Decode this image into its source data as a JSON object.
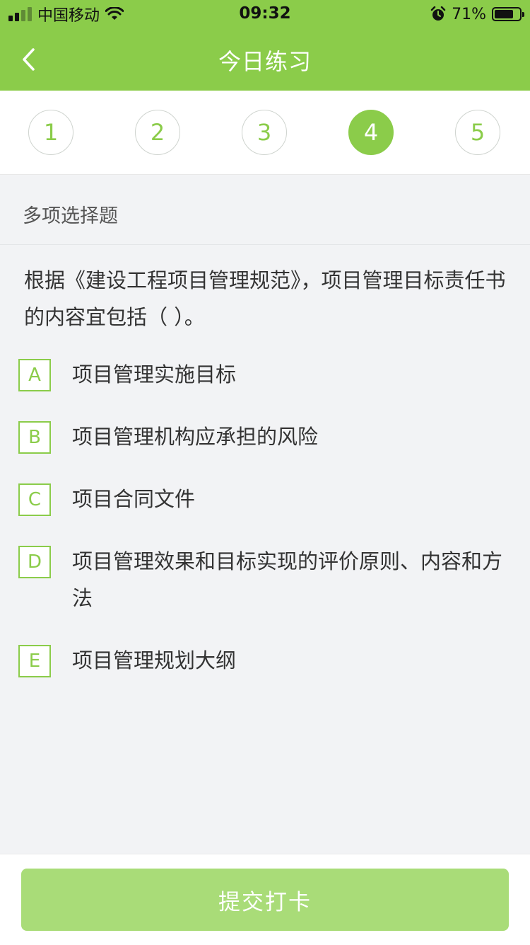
{
  "status_bar": {
    "carrier": "中国移动",
    "time": "09:32",
    "battery": "71%"
  },
  "header": {
    "title": "今日练习"
  },
  "steps": [
    "1",
    "2",
    "3",
    "4",
    "5"
  ],
  "active_step": "4",
  "question": {
    "type": "多项选择题",
    "text": "根据《建设工程项目管理规范》，项目管理目标责任书的内容宜包括（   ）。",
    "options": [
      {
        "letter": "A",
        "text": "项目管理实施目标"
      },
      {
        "letter": "B",
        "text": "项目管理机构应承担的风险"
      },
      {
        "letter": "C",
        "text": "项目合同文件"
      },
      {
        "letter": "D",
        "text": "项目管理效果和目标实现的评价原则、内容和方法"
      },
      {
        "letter": "E",
        "text": "项目管理规划大纲"
      }
    ]
  },
  "footer": {
    "submit_label": "提交打卡"
  },
  "colors": {
    "brand_green": "#8bcc4a",
    "button_green": "#a9dc78",
    "background": "#f2f3f5"
  },
  "icons": [
    "signal-icon",
    "wifi-icon",
    "alarm-icon",
    "battery-icon",
    "back-arrow-icon"
  ]
}
